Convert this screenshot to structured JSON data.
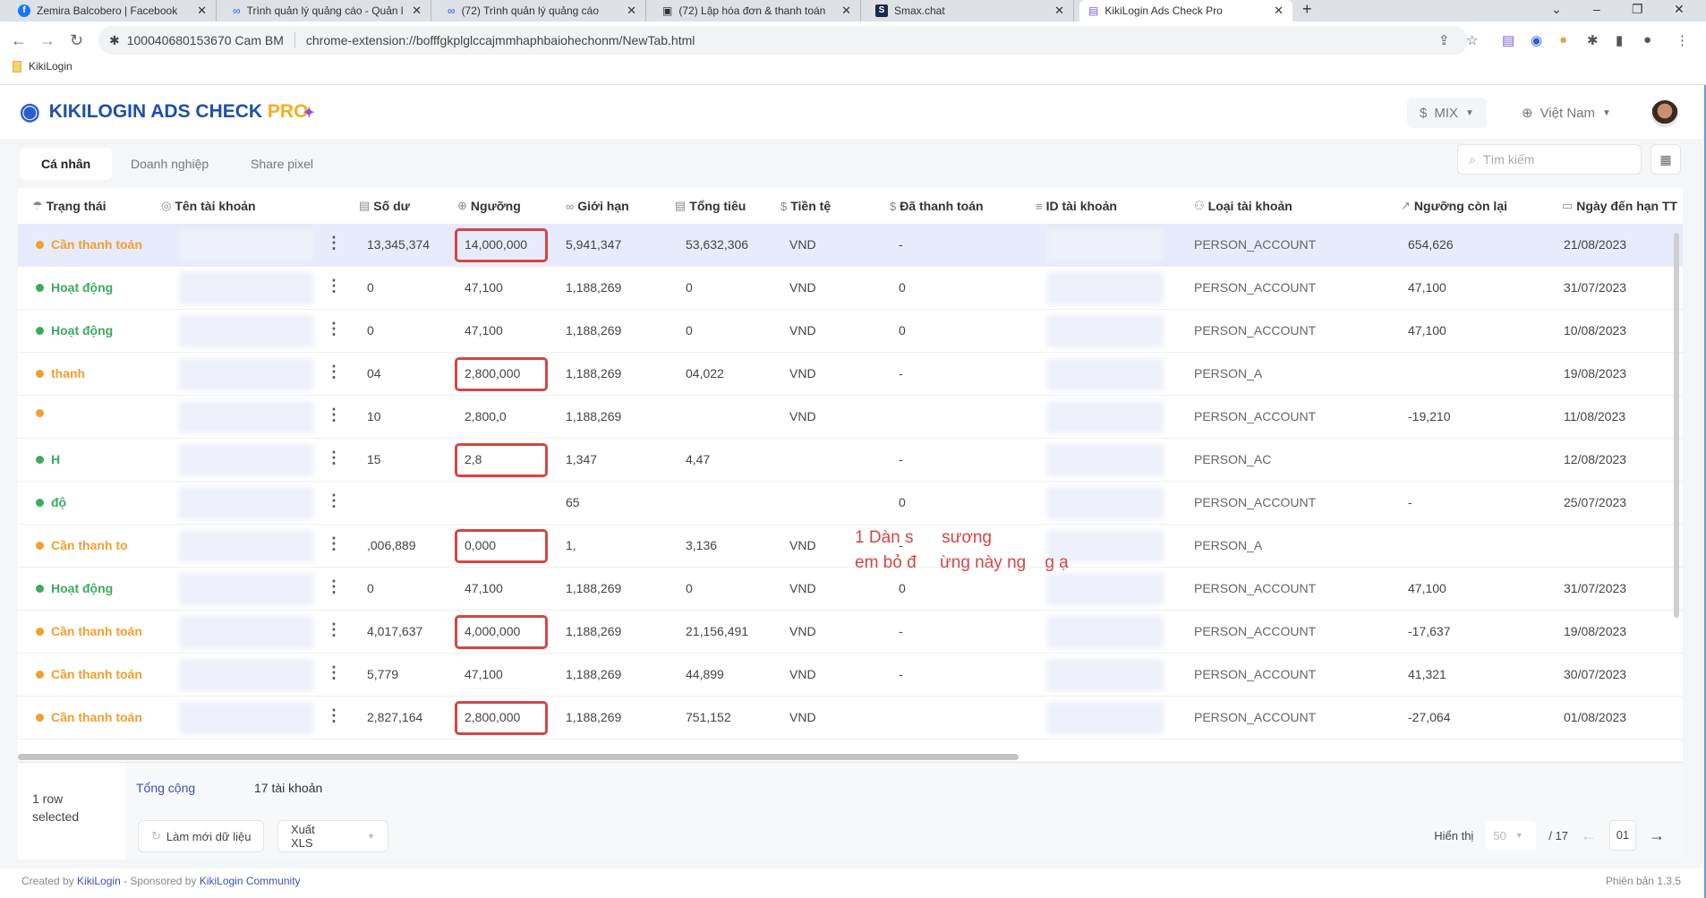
{
  "browser": {
    "tabs": [
      {
        "title": "Zemira Balcobero | Facebook",
        "icon": "facebook-icon",
        "active": false
      },
      {
        "title": "Trình quản lý quảng cáo - Quản l",
        "icon": "meta-icon",
        "active": false
      },
      {
        "title": "(72) Trình quản lý quảng cáo",
        "icon": "meta-icon",
        "active": false
      },
      {
        "title": "(72) Lập hóa đơn & thanh toán",
        "icon": "billing-icon",
        "active": false
      },
      {
        "title": "Smax.chat",
        "icon": "smax-icon",
        "active": false
      },
      {
        "title": "KikiLogin Ads Check Pro",
        "icon": "kikilogin-icon",
        "active": true
      }
    ],
    "profile_label": "100040680153670 Cam BM",
    "url": "chrome-extension://bofffgkplglccajmmhaphbaiohechonm/NewTab.html",
    "bookmark": "KikiLogin"
  },
  "app": {
    "logo_main": "KIKILOGIN ADS CHECK ",
    "logo_pro": "PRO",
    "mix_label": "MIX",
    "language": "Việt Nam"
  },
  "page_tabs": [
    {
      "label": "Cá nhân",
      "active": true
    },
    {
      "label": "Doanh nghiệp",
      "active": false
    },
    {
      "label": "Share pixel",
      "active": false
    }
  ],
  "search": {
    "placeholder": "Tìm kiếm"
  },
  "columns": {
    "status": "Trạng thái",
    "name": "Tên tài khoản",
    "balance": "Số dư",
    "threshold": "Ngưỡng",
    "limit": "Giới hạn",
    "spent": "Tổng tiêu",
    "currency": "Tiền tệ",
    "paid": "Đã thanh toán",
    "id": "ID tài khoản",
    "type": "Loại tài khoản",
    "remaining": "Ngưỡng còn lại",
    "due": "Ngày đến hạn TT"
  },
  "status_colors": {
    "pay": "#f0a030",
    "active": "#3daa60"
  },
  "rows": [
    {
      "status": "Cần thanh toán",
      "kind": "pay",
      "balance": "13,345,374",
      "threshold": "14,000,000",
      "boxed": true,
      "limit": "5,941,347",
      "spent": "53,632,306",
      "currency": "VND",
      "paid": "-",
      "type": "PERSON_ACCOUNT",
      "remaining": "654,626",
      "due": "21/08/2023",
      "selected": true
    },
    {
      "status": "Hoạt động",
      "kind": "active",
      "balance": "0",
      "threshold": "47,100",
      "boxed": false,
      "limit": "1,188,269",
      "spent": "0",
      "currency": "VND",
      "paid": "0",
      "type": "PERSON_ACCOUNT",
      "remaining": "47,100",
      "due": "31/07/2023"
    },
    {
      "status": "Hoạt động",
      "kind": "active",
      "balance": "0",
      "threshold": "47,100",
      "boxed": false,
      "limit": "1,188,269",
      "spent": "0",
      "currency": "VND",
      "paid": "0",
      "type": "PERSON_ACCOUNT",
      "remaining": "47,100",
      "due": "10/08/2023"
    },
    {
      "status": "thanh",
      "kind": "pay",
      "balance": "04",
      "threshold": "2,800,000",
      "boxed": true,
      "limit": "1,188,269",
      "spent": "04,022",
      "currency": "VND",
      "paid": "-",
      "type": "PERSON_A",
      "remaining": "",
      "due": "19/08/2023"
    },
    {
      "status": "",
      "kind": "pay",
      "balance": "10",
      "threshold": "2,800,0",
      "boxed": false,
      "limit": "1,188,269",
      "spent": "",
      "currency": "VND",
      "paid": "",
      "type": "PERSON_ACCOUNT",
      "remaining": "-19,210",
      "due": "11/08/2023"
    },
    {
      "status": "H",
      "kind": "active",
      "balance": "15",
      "threshold": "2,8",
      "boxed": true,
      "limit": "1,347",
      "spent": "4,47",
      "currency": "",
      "paid": "-",
      "type": "PERSON_AC",
      "remaining": "",
      "due": "12/08/2023"
    },
    {
      "status": "độ",
      "kind": "active",
      "balance": "",
      "threshold": "",
      "boxed": false,
      "limit": "65",
      "spent": "",
      "currency": "",
      "paid": "0",
      "type": "PERSON_ACCOUNT",
      "remaining": "-",
      "due": "25/07/2023"
    },
    {
      "status": "Cần thanh to",
      "kind": "pay",
      "balance": ",006,889",
      "threshold": "0,000",
      "boxed": true,
      "limit": "1,",
      "spent": "3,136",
      "currency": "VND",
      "paid": "-",
      "type": "PERSON_A",
      "remaining": "",
      "due": ""
    },
    {
      "status": "Hoạt động",
      "kind": "active",
      "balance": "0",
      "threshold": "47,100",
      "boxed": false,
      "limit": "1,188,269",
      "spent": "0",
      "currency": "VND",
      "paid": "0",
      "type": "PERSON_ACCOUNT",
      "remaining": "47,100",
      "due": "31/07/2023"
    },
    {
      "status": "Cần thanh toán",
      "kind": "pay",
      "balance": "4,017,637",
      "threshold": "4,000,000",
      "boxed": true,
      "limit": "1,188,269",
      "spent": "21,156,491",
      "currency": "VND",
      "paid": "-",
      "type": "PERSON_ACCOUNT",
      "remaining": "-17,637",
      "due": "19/08/2023"
    },
    {
      "status": "Cần thanh toán",
      "kind": "pay",
      "balance": "5,779",
      "threshold": "47,100",
      "boxed": false,
      "limit": "1,188,269",
      "spent": "44,899",
      "currency": "VND",
      "paid": "-",
      "type": "PERSON_ACCOUNT",
      "remaining": "41,321",
      "due": "30/07/2023"
    },
    {
      "status": "Cần thanh toán",
      "kind": "pay",
      "balance": "2,827,164",
      "threshold": "2,800,000",
      "boxed": true,
      "limit": "1,188,269",
      "spent": "751,152",
      "currency": "VND",
      "paid": "",
      "type": "PERSON_ACCOUNT",
      "remaining": "-27,064",
      "due": "01/08/2023"
    }
  ],
  "annotation": "1 Dàn s      sương\nem bỏ đ     ừng này ng    g ạ",
  "footer": {
    "selected": "1 row selected",
    "total_label": "Tổng cộng",
    "total_value": "17 tài khoản",
    "refresh": "Làm mới dữ liệu",
    "export": "Xuất XLS",
    "show_label": "Hiển thị",
    "page_size": "50",
    "pages": "/ 17",
    "page": "01",
    "credit_prefix": "Created by ",
    "credit_link1": "KikiLogin",
    "credit_mid": " - Sponsored by ",
    "credit_link2": "KikiLogin Community",
    "version": "Phiên bản 1.3.5"
  }
}
